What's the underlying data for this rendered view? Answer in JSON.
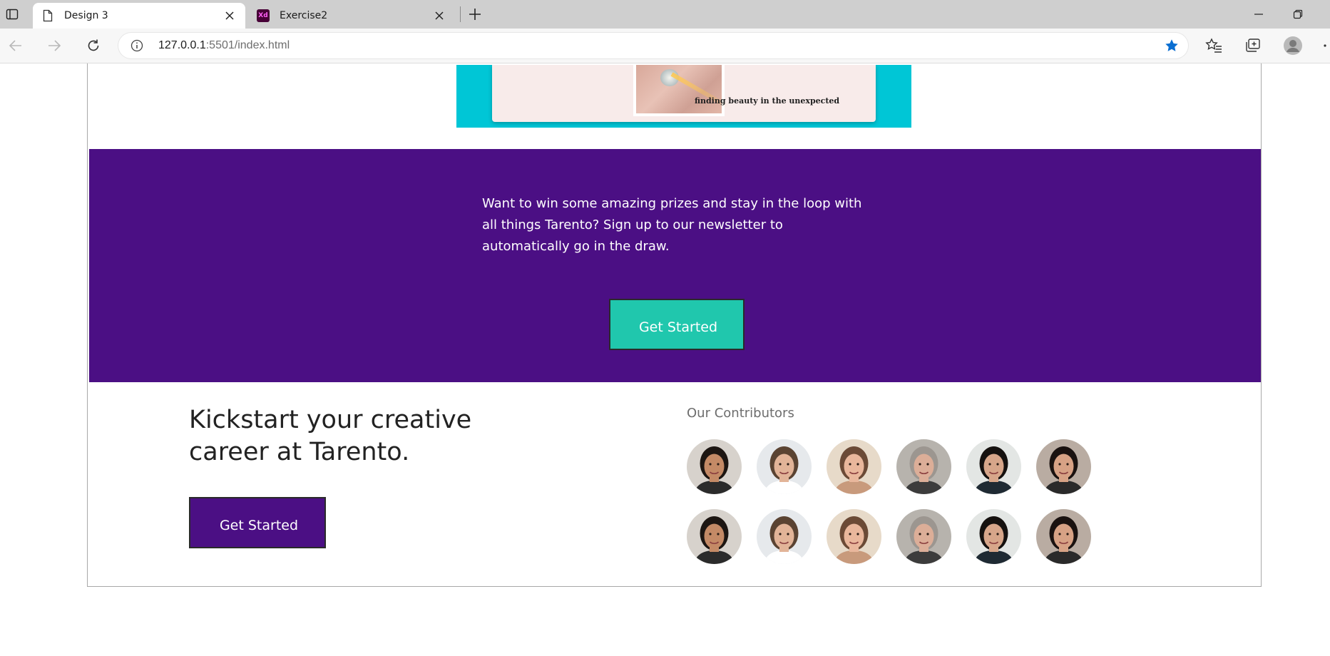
{
  "browser": {
    "tabs": [
      {
        "title": "Design 3",
        "icon": "page-icon",
        "active": true
      },
      {
        "title": "Exercise2",
        "icon": "xd-icon",
        "badge": "Xd",
        "active": false
      }
    ],
    "url": {
      "host": "127.0.0.1",
      "port": ":5501",
      "path": "/index.html"
    },
    "colors": {
      "bookmark_star": "#0a6ed1"
    }
  },
  "hero": {
    "caption": "finding beauty in the unexpected",
    "colors": {
      "background": "#00c6d6",
      "card": "#f8ebea"
    }
  },
  "promo": {
    "text": "Want to win some amazing prizes and stay in the loop with all things Tarento? Sign up to our newsletter to automatically go in the draw.",
    "button_label": "Get Started",
    "colors": {
      "background": "#4b0f84",
      "button": "#20c7ad"
    }
  },
  "kickstart": {
    "title": "Kickstart your creative career at Tarento.",
    "button_label": "Get Started",
    "colors": {
      "button": "#4b0f84"
    }
  },
  "contributors": {
    "label": "Our Contributors",
    "avatars": [
      {
        "name": "contributor-avatar-1",
        "hair": "#1d1612",
        "skin": "#c48a66",
        "bg": "#d7d2cc",
        "shirt": "#2b2b2b"
      },
      {
        "name": "contributor-avatar-2",
        "hair": "#5a4332",
        "skin": "#e2b498",
        "bg": "#e6e9ec",
        "shirt": "#ffffff"
      },
      {
        "name": "contributor-avatar-3",
        "hair": "#6b4a36",
        "skin": "#e9b79c",
        "bg": "#e7dac9",
        "shirt": "#c89a7c"
      },
      {
        "name": "contributor-avatar-4",
        "hair": "#9c9690",
        "skin": "#dcae98",
        "bg": "#b7b3ad",
        "shirt": "#3c3c3c"
      },
      {
        "name": "contributor-avatar-5",
        "hair": "#15110f",
        "skin": "#d7a68a",
        "bg": "#e3e6e4",
        "shirt": "#1f2a33"
      },
      {
        "name": "contributor-avatar-6",
        "hair": "#1a1210",
        "skin": "#d7a285",
        "bg": "#b9aca2",
        "shirt": "#2a2a2a"
      },
      {
        "name": "contributor-avatar-7",
        "hair": "#1d1612",
        "skin": "#c48a66",
        "bg": "#d7d2cc",
        "shirt": "#2b2b2b"
      },
      {
        "name": "contributor-avatar-8",
        "hair": "#5a4332",
        "skin": "#e2b498",
        "bg": "#e6e9ec",
        "shirt": "#ffffff"
      },
      {
        "name": "contributor-avatar-9",
        "hair": "#6b4a36",
        "skin": "#e9b79c",
        "bg": "#e7dac9",
        "shirt": "#c89a7c"
      },
      {
        "name": "contributor-avatar-10",
        "hair": "#9c9690",
        "skin": "#dcae98",
        "bg": "#b7b3ad",
        "shirt": "#3c3c3c"
      },
      {
        "name": "contributor-avatar-11",
        "hair": "#15110f",
        "skin": "#d7a68a",
        "bg": "#e3e6e4",
        "shirt": "#1f2a33"
      },
      {
        "name": "contributor-avatar-12",
        "hair": "#1a1210",
        "skin": "#d7a285",
        "bg": "#b9aca2",
        "shirt": "#2a2a2a"
      }
    ]
  }
}
